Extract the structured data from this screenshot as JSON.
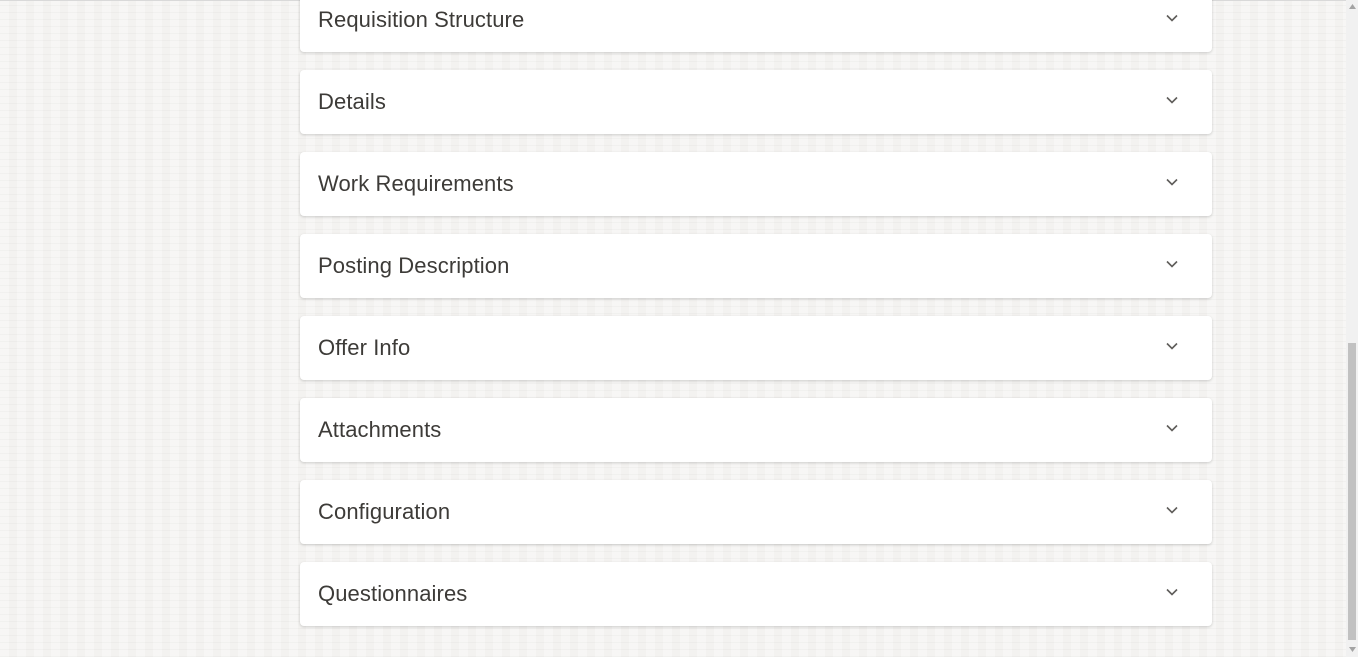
{
  "sections": [
    {
      "title": "Requisition Structure",
      "icon": "chevron-down-icon"
    },
    {
      "title": "Details",
      "icon": "chevron-down-icon"
    },
    {
      "title": "Work Requirements",
      "icon": "chevron-down-icon"
    },
    {
      "title": "Posting Description",
      "icon": "chevron-down-icon"
    },
    {
      "title": "Offer Info",
      "icon": "chevron-down-icon"
    },
    {
      "title": "Attachments",
      "icon": "chevron-down-icon"
    },
    {
      "title": "Configuration",
      "icon": "chevron-down-icon"
    },
    {
      "title": "Questionnaires",
      "icon": "chevron-down-icon"
    }
  ],
  "colors": {
    "background": "#f3f2f0",
    "card": "#ffffff",
    "text": "#3d3b38",
    "chevron": "#5f5d5a",
    "scrollbar_track": "#f1f1f1",
    "scrollbar_thumb": "#c1c1c1"
  }
}
